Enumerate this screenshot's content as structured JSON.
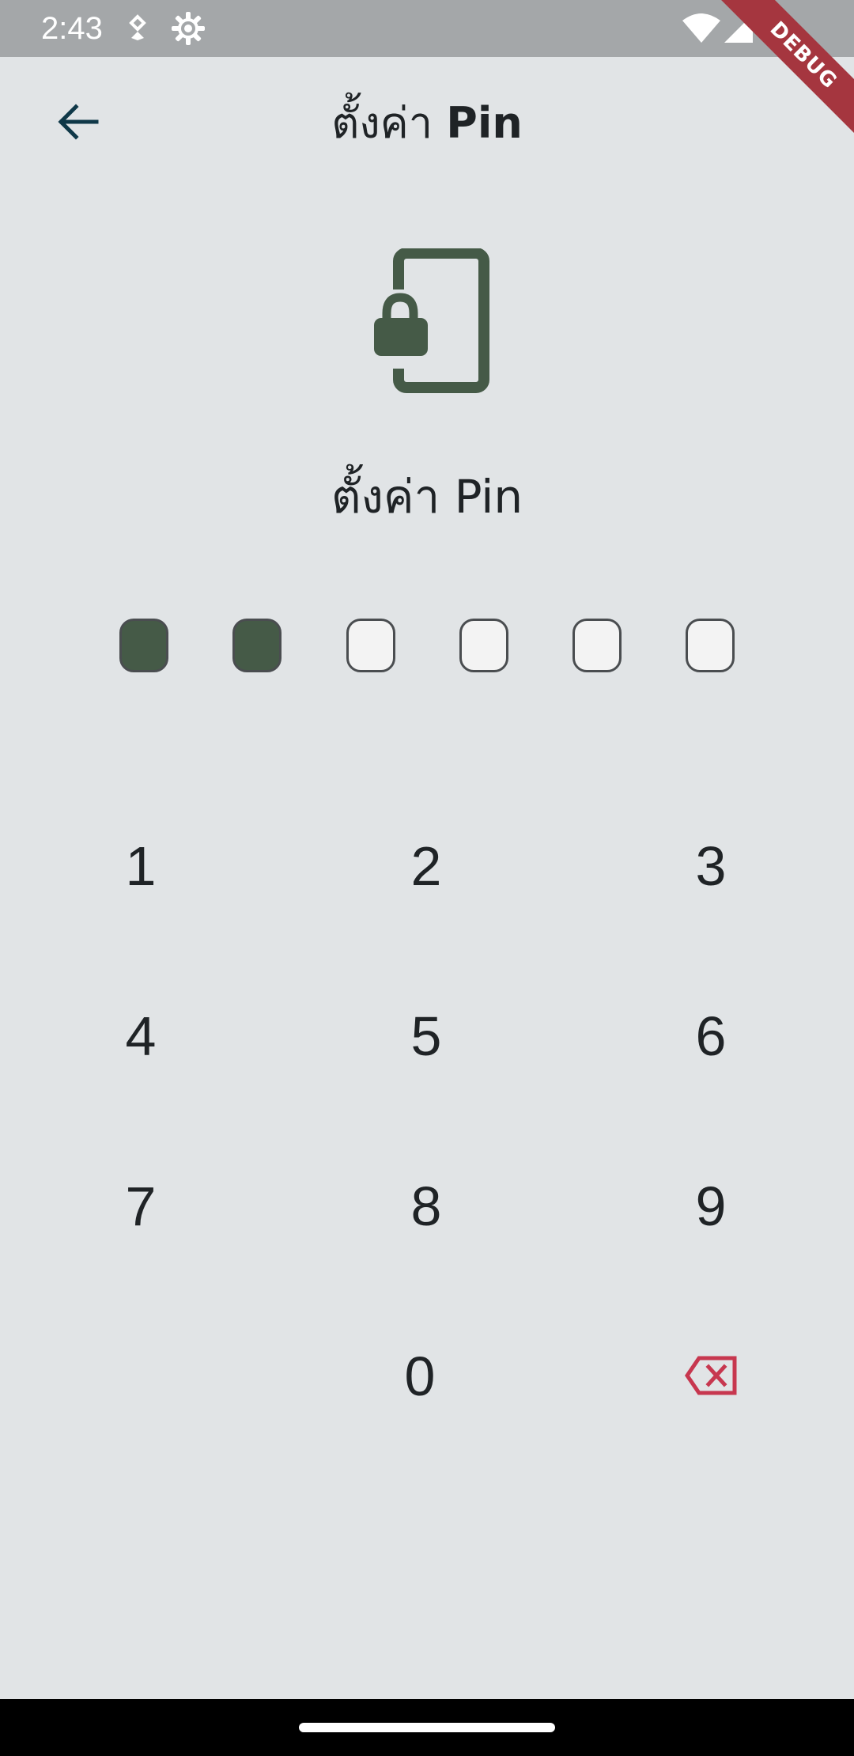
{
  "status_bar": {
    "time": "2:43",
    "icons": [
      "location-icon",
      "settings-gear-icon",
      "wifi-icon",
      "cell-signal-icon",
      "battery-icon"
    ]
  },
  "debug_banner": "DEBUG",
  "app_bar": {
    "back_icon": "arrow-back-icon",
    "title_prefix": "ตั้งค่า",
    "title_bold": "Pin"
  },
  "hero": {
    "icon": "phone-lock-icon",
    "color": "#455a47"
  },
  "subtitle": "ตั้งค่า Pin",
  "pin": {
    "length": 6,
    "filled": 2
  },
  "keypad": {
    "keys": [
      "1",
      "2",
      "3",
      "4",
      "5",
      "6",
      "7",
      "8",
      "9",
      "0"
    ],
    "backspace_icon": "backspace-icon",
    "backspace_color": "#c7374f"
  },
  "colors": {
    "background": "#e1e4e6",
    "status_bar": "#a4a7a9",
    "accent": "#455a47"
  }
}
